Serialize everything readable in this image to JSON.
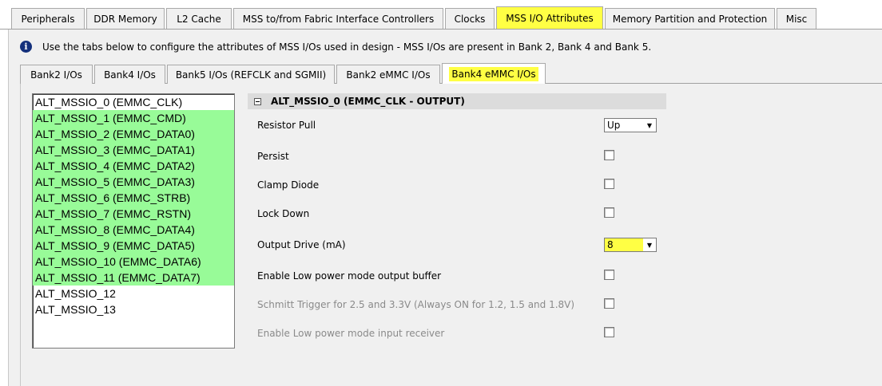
{
  "top_tabs": [
    {
      "label": "Peripherals"
    },
    {
      "label": "DDR Memory"
    },
    {
      "label": "L2 Cache"
    },
    {
      "label": "MSS to/from Fabric Interface Controllers"
    },
    {
      "label": "Clocks"
    },
    {
      "label": "MSS I/O Attributes"
    },
    {
      "label": "Memory Partition and Protection"
    },
    {
      "label": "Misc"
    }
  ],
  "info": {
    "icon": "info-icon",
    "text": "Use the tabs below to configure the attributes of MSS I/Os used in design - MSS I/Os are present in Bank 2, Bank 4 and Bank 5."
  },
  "sub_tabs": [
    {
      "label": "Bank2 I/Os"
    },
    {
      "label": "Bank4 I/Os"
    },
    {
      "label": "Bank5 I/Os (REFCLK and SGMII)"
    },
    {
      "label": "Bank2 eMMC I/Os"
    },
    {
      "label": "Bank4 eMMC I/Os"
    }
  ],
  "io_list": [
    {
      "label": "ALT_MSSIO_0 (EMMC_CLK)"
    },
    {
      "label": "ALT_MSSIO_1 (EMMC_CMD)"
    },
    {
      "label": "ALT_MSSIO_2 (EMMC_DATA0)"
    },
    {
      "label": "ALT_MSSIO_3 (EMMC_DATA1)"
    },
    {
      "label": "ALT_MSSIO_4 (EMMC_DATA2)"
    },
    {
      "label": "ALT_MSSIO_5 (EMMC_DATA3)"
    },
    {
      "label": "ALT_MSSIO_6 (EMMC_STRB)"
    },
    {
      "label": "ALT_MSSIO_7 (EMMC_RSTN)"
    },
    {
      "label": "ALT_MSSIO_8 (EMMC_DATA4)"
    },
    {
      "label": "ALT_MSSIO_9 (EMMC_DATA5)"
    },
    {
      "label": "ALT_MSSIO_10 (EMMC_DATA6)"
    },
    {
      "label": "ALT_MSSIO_11 (EMMC_DATA7)"
    },
    {
      "label": "ALT_MSSIO_12"
    },
    {
      "label": "ALT_MSSIO_13"
    }
  ],
  "properties": {
    "header": "ALT_MSSIO_0 (EMMC_CLK - OUTPUT)",
    "resistor_pull": {
      "label": "Resistor Pull",
      "value": "Up"
    },
    "persist": {
      "label": "Persist"
    },
    "clamp_diode": {
      "label": "Clamp Diode"
    },
    "lock_down": {
      "label": "Lock Down"
    },
    "output_drive": {
      "label": "Output Drive (mA)",
      "value": "8"
    },
    "low_power_output": {
      "label": "Enable Low power mode output buffer"
    },
    "schmitt_trigger": {
      "label": "Schmitt Trigger for 2.5 and 3.3V (Always ON for 1.2, 1.5 and 1.8V)"
    },
    "low_power_input": {
      "label": "Enable Low power mode input receiver"
    }
  },
  "colors": {
    "highlight": "#ffff44",
    "selected_row": "#98fb98"
  }
}
